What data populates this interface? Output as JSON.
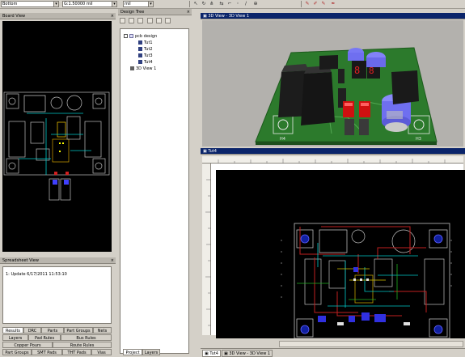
{
  "toolbar": {
    "layer_combo": "Bottom",
    "grid_combo": "G:1.50000 mil",
    "unit_combo": "mil"
  },
  "board_view": {
    "title": "Board View"
  },
  "spreadsheet": {
    "title": "Spreadsheet View",
    "row_text": "1: Update 6/17/2011 11:53:10",
    "tabs": [
      "Results",
      "DRC",
      "Parts",
      "Part Groups",
      "Nets",
      "Layers",
      "Pad Rules",
      "Bus Rules",
      "Copper Pours",
      "Route Rules",
      "Part Groups",
      "SMT Pads",
      "THT Pads",
      "Vias"
    ]
  },
  "design_tree": {
    "title": "Design Tree",
    "items": [
      {
        "label": "pcb design"
      },
      {
        "label": "Tut1"
      },
      {
        "label": "Tut2"
      },
      {
        "label": "Tut3"
      },
      {
        "label": "Tut4"
      },
      {
        "label": "3D View 1"
      }
    ],
    "tabs": [
      "Project",
      "Layers"
    ]
  },
  "view3d": {
    "title": "3D View - 3D View 1",
    "labels": [
      "H4",
      "H3"
    ]
  },
  "pcb_layout": {
    "title": "Tut4"
  },
  "bottom_tabs": [
    "Tut4",
    "3D View - 3D View 1"
  ],
  "colors": {
    "panel_bg": "#d4d0c8",
    "active_title": "#0a246a",
    "board_green": "#2c7a2c",
    "led_red": "#d01010",
    "cap_blue": "#6f6ff0"
  }
}
